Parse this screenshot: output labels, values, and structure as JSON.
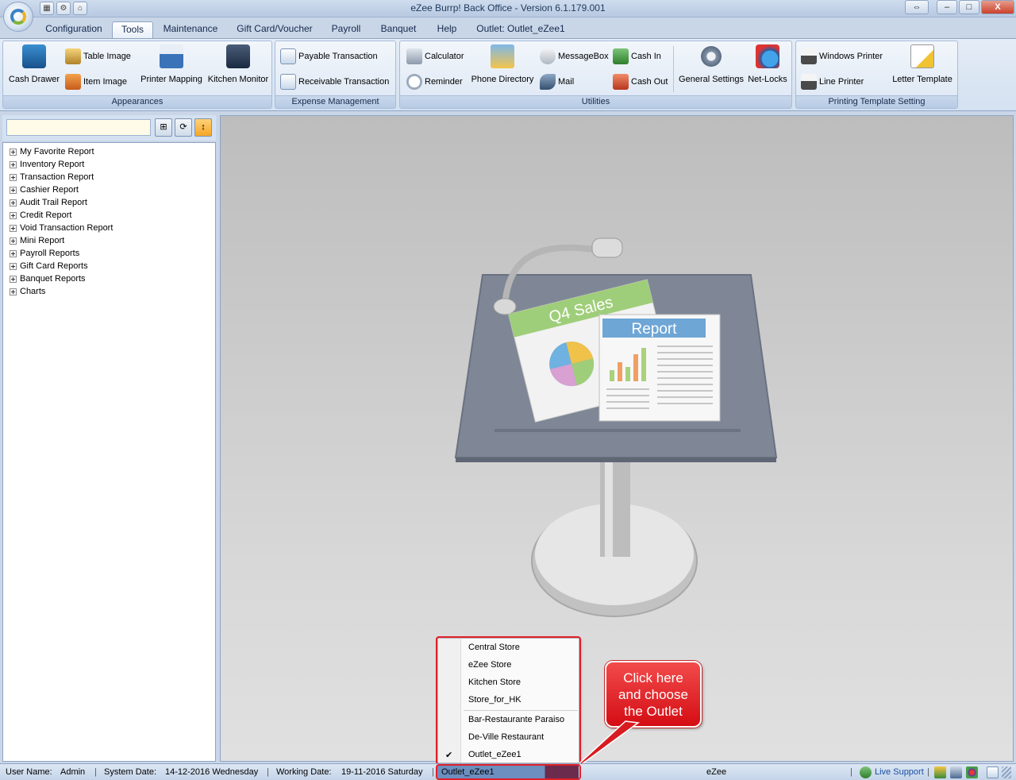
{
  "window": {
    "title": "eZee Burrp! Back Office - Version 6.1.179.001",
    "minimize": "–",
    "restore": "□",
    "close": "X",
    "swap": "⇔"
  },
  "ribbon_tabs": [
    "Configuration",
    "Tools",
    "Maintenance",
    "Gift Card/Voucher",
    "Payroll",
    "Banquet",
    "Help",
    "Outlet: Outlet_eZee1"
  ],
  "active_tab": "Tools",
  "ribbon": {
    "appearances": {
      "label": "Appearances",
      "cash_drawer": "Cash Drawer",
      "table_image": "Table Image",
      "item_image": "Item Image",
      "printer_mapping": "Printer Mapping",
      "kitchen_monitor": "Kitchen Monitor"
    },
    "expense": {
      "label": "Expense Management",
      "payable": "Payable Transaction",
      "receivable": "Receivable Transaction"
    },
    "utilities": {
      "label": "Utilities",
      "calculator": "Calculator",
      "reminder": "Reminder",
      "phone_directory": "Phone Directory",
      "messagebox": "MessageBox",
      "mail": "Mail",
      "cash_in": "Cash In",
      "cash_out": "Cash Out",
      "general_settings": "General Settings",
      "net_locks": "Net-Locks"
    },
    "printing": {
      "label": "Printing Template Setting",
      "windows_printer": "Windows Printer",
      "line_printer": "Line Printer",
      "letter_template": "Letter Template"
    }
  },
  "search": {
    "value": "",
    "placeholder": ""
  },
  "tree": [
    "My Favorite Report",
    "Inventory Report",
    "Transaction Report",
    "Cashier Report",
    "Audit Trail Report",
    "Credit Report",
    "Void Transaction Report",
    "Mini Report",
    "Payroll Reports",
    "Gift Card Reports",
    "Banquet Reports",
    "Charts"
  ],
  "illustration": {
    "card1": "Q4 Sales",
    "card2": "Report"
  },
  "outlet_menu": {
    "stores": [
      "Central Store",
      "eZee Store",
      "Kitchen Store",
      "Store_for_HK"
    ],
    "outlets": [
      "Bar-Restaurante Paraiso",
      "De-Ville Restaurant",
      "Outlet_eZee1"
    ],
    "checked": "Outlet_eZee1",
    "check_mark": "✔"
  },
  "callout": {
    "line1": "Click here",
    "line2": "and choose",
    "line3": "the Outlet"
  },
  "status": {
    "user_label": "User Name:",
    "user_value": "Admin",
    "system_date_label": "System Date:",
    "system_date_value": "14-12-2016 Wednesday",
    "working_date_label": "Working Date:",
    "working_date_value": "19-11-2016 Saturday",
    "outlet_value": "Outlet_eZee1",
    "center_text": "eZee",
    "live_support": "Live Support",
    "divider": "|"
  },
  "colors": {
    "accent_red": "#e0202a",
    "ribbon_bg": "#d4e1f1",
    "outlet_combo": "#6c8fc0"
  }
}
